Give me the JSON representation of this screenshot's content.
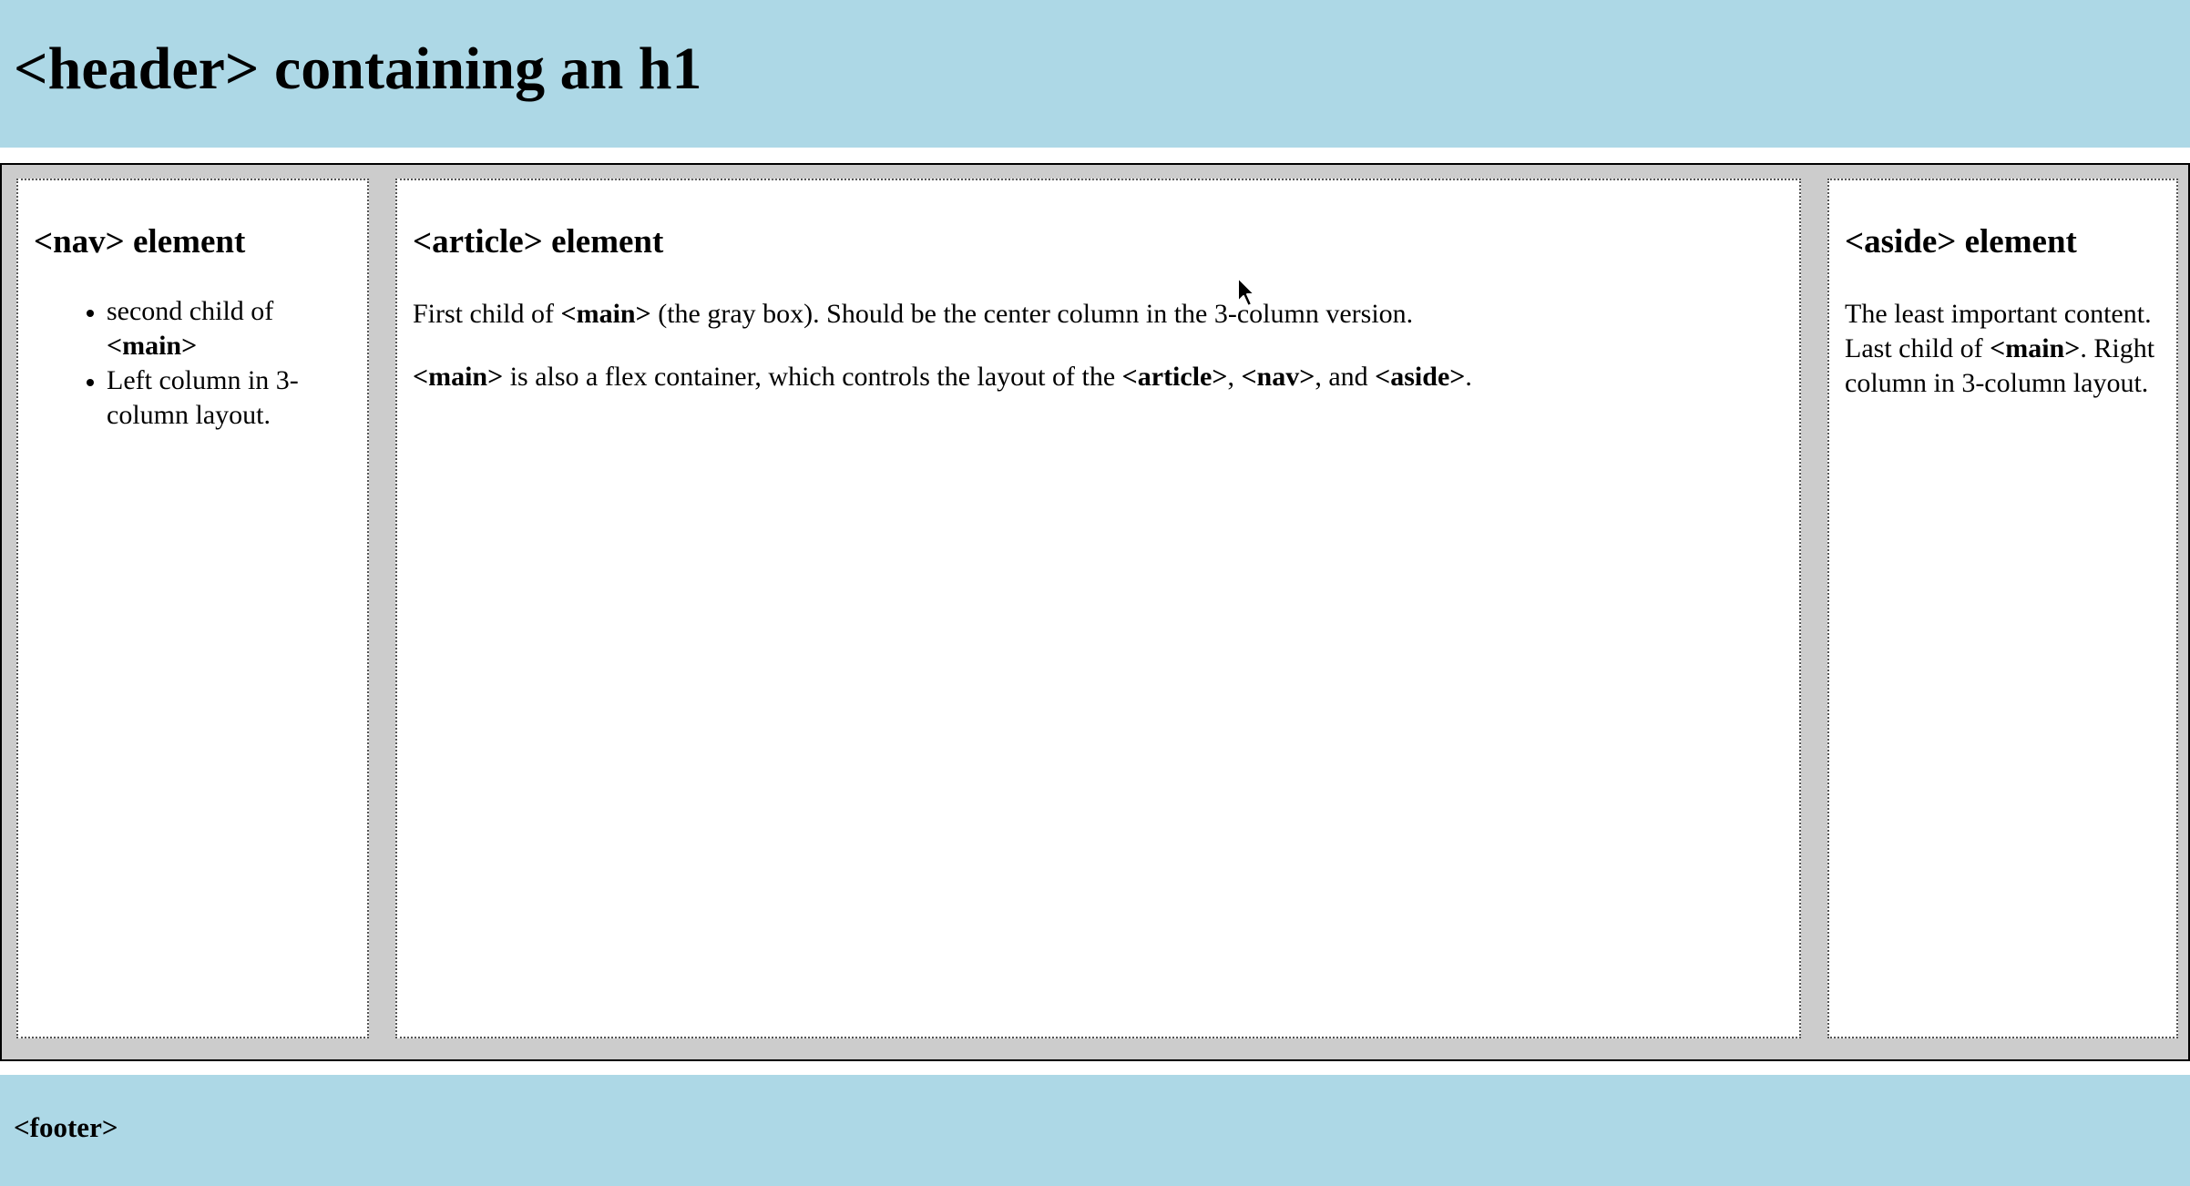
{
  "header": {
    "title": "<header> containing an h1"
  },
  "nav": {
    "heading": "<nav> element",
    "items": [
      {
        "text": "second child of ",
        "bold": "<main>"
      },
      {
        "text": "Left column in 3-column layout."
      }
    ]
  },
  "article": {
    "heading": "<article> element",
    "p1": {
      "pre": "First child of ",
      "bold": "<main>",
      "post": " (the gray box). Should be the center column in the 3-column version."
    },
    "p2": {
      "bold1": "<main>",
      "mid1": " is also a flex container, which controls the layout of the ",
      "bold2": "<article>",
      "sep1": ", ",
      "bold3": "<nav>",
      "sep2": ", and ",
      "bold4": "<aside>",
      "end": "."
    }
  },
  "aside": {
    "heading": "<aside> element",
    "pre": "The least important content. Last child of ",
    "bold": "<main>",
    "post": ". Right column in 3-column layout."
  },
  "footer": {
    "text": "<footer>"
  },
  "colors": {
    "header_bg": "#add8e6",
    "main_bg": "#cccccc",
    "column_bg": "#ffffff"
  },
  "icons": {
    "cursor": "arrow-cursor-icon"
  }
}
